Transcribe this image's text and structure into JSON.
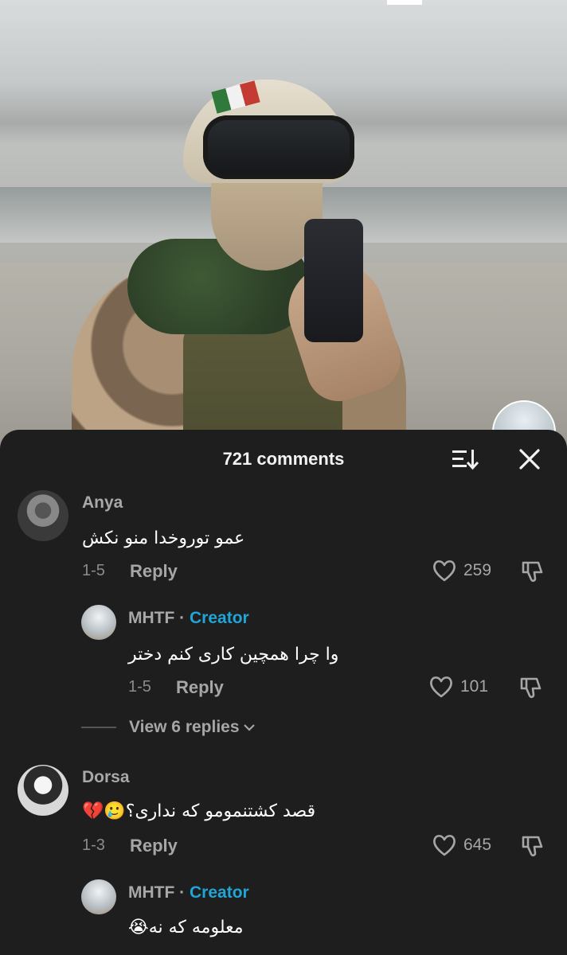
{
  "header": {
    "comment_count": "721 comments",
    "sort_icon": "sort-icon",
    "close_icon": "close-icon"
  },
  "comments": [
    {
      "username": "Anya",
      "text": "عمو توروخدا منو نکش",
      "date": "1-5",
      "reply_label": "Reply",
      "likes": "259",
      "reply": {
        "username": "MHTF",
        "separator": "·",
        "badge": "Creator",
        "text": "وا چرا همچین کاری کنم دختر",
        "date": "1-5",
        "reply_label": "Reply",
        "likes": "101"
      },
      "view_replies": "View 6 replies"
    },
    {
      "username": "Dorsa",
      "text": "قصد کشتنمومو که نداری؟🥲💔",
      "date": "1-3",
      "reply_label": "Reply",
      "likes": "645",
      "reply": {
        "username": "MHTF",
        "separator": "·",
        "badge": "Creator",
        "text": "معلومه که نه😭"
      }
    }
  ],
  "colors": {
    "background": "#1e1e1e",
    "creator_badge": "#1fa5d6",
    "muted_text": "#a6a6a6"
  }
}
